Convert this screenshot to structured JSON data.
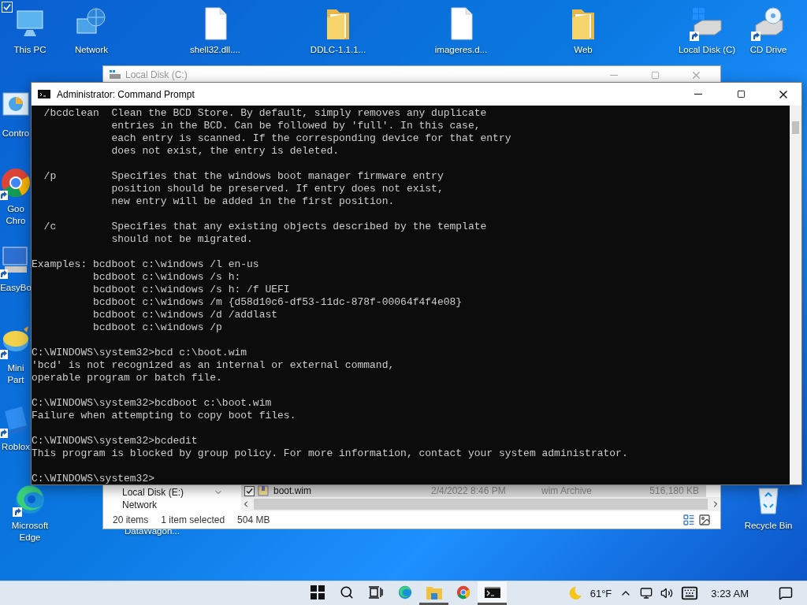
{
  "desktop_icons": [
    {
      "label": "This PC",
      "kind": "pc",
      "shortcut": false,
      "checked": true
    },
    {
      "label": "Network",
      "kind": "network",
      "shortcut": false,
      "checked": false
    },
    {
      "label": "shell32.dll....",
      "kind": "file",
      "shortcut": false,
      "checked": false
    },
    {
      "label": "DDLC-1.1.1...",
      "kind": "folder",
      "shortcut": false,
      "checked": false
    },
    {
      "label": "imageres.d...",
      "kind": "file",
      "shortcut": false,
      "checked": false
    },
    {
      "label": "Web",
      "kind": "folder",
      "shortcut": false,
      "checked": false
    },
    {
      "label": "Local Disk (C)",
      "kind": "drive",
      "shortcut": true,
      "checked": false
    },
    {
      "label": "CD Drive",
      "kind": "cd",
      "shortcut": true,
      "checked": false
    },
    {
      "label": "Contro",
      "kind": "control",
      "shortcut": false,
      "checked": false
    },
    {
      "label": "Goo\nChro",
      "kind": "chrome",
      "shortcut": true,
      "checked": false
    },
    {
      "label": "EasyBo",
      "kind": "easybcd",
      "shortcut": true,
      "checked": false
    },
    {
      "label": "Mini\nPart",
      "kind": "minitool",
      "shortcut": true,
      "checked": false
    },
    {
      "label": "Roblox",
      "kind": "roblox",
      "shortcut": true,
      "checked": false
    },
    {
      "label": "Microsoft\nEdge",
      "kind": "edge",
      "shortcut": true,
      "checked": false
    },
    {
      "label": "Recycle Bin",
      "kind": "recycle",
      "shortcut": false,
      "checked": false
    }
  ],
  "desktop_label": "DataWagon...",
  "explorer": {
    "title": "Local Disk (C:)",
    "nav_items": [
      "Local Disk (E:)",
      "Network"
    ],
    "file_row": {
      "checked": true,
      "name": "boot.wim",
      "date": "2/4/2022 8:46 PM",
      "type": "wim Archive",
      "size": "516,180 KB"
    },
    "status": [
      "20 items",
      "1 item selected",
      "504 MB"
    ]
  },
  "console": {
    "title": "Administrator: Command Prompt",
    "blocks": [
      [
        "  /bcdclean  Clean the BCD Store. By default, simply removes any duplicate",
        "             entries in the BCD. Can be followed by 'full'. In this case,",
        "             each entry is scanned. If the corresponding device for that entry",
        "             does not exist, the entry is deleted."
      ],
      [
        "  /p         Specifies that the windows boot manager firmware entry",
        "             position should be preserved. If entry does not exist,",
        "             new entry will be added in the first position."
      ],
      [
        "  /c         Specifies that any existing objects described by the template",
        "             should not be migrated."
      ],
      [
        "Examples: bcdboot c:\\windows /l en-us",
        "          bcdboot c:\\windows /s h:",
        "          bcdboot c:\\windows /s h: /f UEFI",
        "          bcdboot c:\\windows /m {d58d10c6-df53-11dc-878f-00064f4f4e08}",
        "          bcdboot c:\\windows /d /addlast",
        "          bcdboot c:\\windows /p"
      ],
      [
        "C:\\WINDOWS\\system32>bcd c:\\boot.wim",
        "'bcd' is not recognized as an internal or external command,",
        "operable program or batch file."
      ],
      [
        "C:\\WINDOWS\\system32>bcdboot c:\\boot.wim",
        "Failure when attempting to copy boot files."
      ],
      [
        "C:\\WINDOWS\\system32>bcdedit",
        "This program is blocked by group policy. For more information, contact your system administrator."
      ],
      [
        "C:\\WINDOWS\\system32>"
      ]
    ]
  },
  "taskbar": {
    "items": [
      {
        "kind": "start",
        "running": false,
        "selected": false
      },
      {
        "kind": "search",
        "running": false,
        "selected": false
      },
      {
        "kind": "taskview",
        "running": false,
        "selected": false
      },
      {
        "kind": "edge",
        "running": false,
        "selected": false
      },
      {
        "kind": "explorer",
        "running": true,
        "selected": false
      },
      {
        "kind": "chrome",
        "running": false,
        "selected": false
      },
      {
        "kind": "cmd",
        "running": true,
        "selected": true
      }
    ],
    "temperature": "61°F",
    "time": "3:23 AM"
  }
}
